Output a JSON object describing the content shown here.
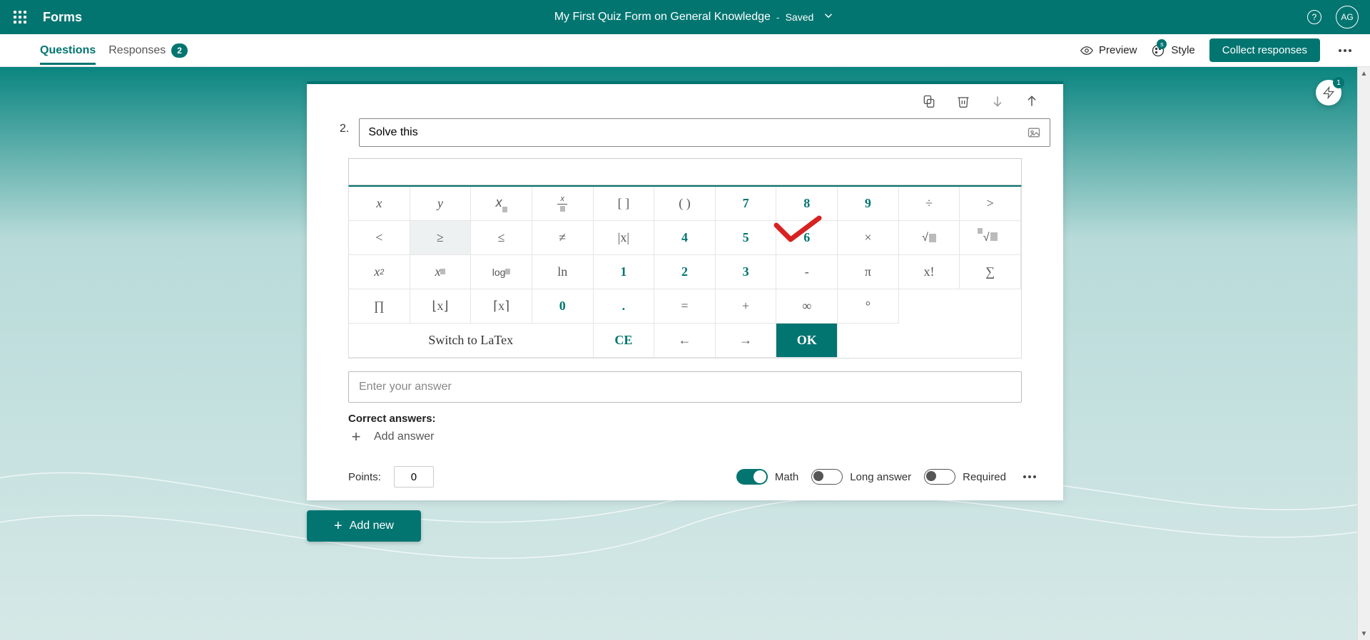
{
  "header": {
    "app_name": "Forms",
    "form_title": "My First Quiz Form on General Knowledge",
    "saved_dash": "-",
    "saved_text": "Saved",
    "avatar_initials": "AG",
    "help_glyph": "?"
  },
  "toolbar": {
    "tab_questions": "Questions",
    "tab_responses": "Responses",
    "responses_count": "2",
    "preview_label": "Preview",
    "style_label": "Style",
    "style_badge": "s",
    "collect_label": "Collect responses"
  },
  "insights": {
    "count": "1"
  },
  "question": {
    "number": "2.",
    "text": "Solve this",
    "answer_placeholder": "Enter your answer",
    "correct_answers_label": "Correct answers:",
    "add_answer_label": "Add answer",
    "points_label": "Points:",
    "points_value": "0"
  },
  "keypad": {
    "rows": [
      [
        "x",
        "y",
        "x_sub",
        "frac",
        "[ ]",
        "( )",
        "",
        "7",
        "8",
        "9",
        "÷"
      ],
      [
        ">",
        "<",
        "≥",
        "≤",
        "≠",
        "|x|",
        "",
        "4",
        "5",
        "6",
        "×"
      ],
      [
        "sqrt",
        "nroot",
        "x^2",
        "x^n",
        "log_n",
        "ln",
        "",
        "1",
        "2",
        "3",
        "-"
      ],
      [
        "π",
        "x!",
        "∑",
        "∏",
        "⌊x⌋",
        "⌈x⌉",
        "",
        "0",
        ".",
        "=",
        "+"
      ],
      [
        "∞",
        "°",
        "Switch to LaTex",
        "",
        "",
        "",
        "",
        "CE",
        "←",
        "→",
        "OK"
      ]
    ],
    "switch_latex": "Switch to LaTex",
    "ce": "CE",
    "ok": "OK"
  },
  "footer": {
    "math_label": "Math",
    "long_answer_label": "Long answer",
    "required_label": "Required",
    "math_on": true,
    "long_answer_on": false,
    "required_on": false
  },
  "add_new": "Add new"
}
